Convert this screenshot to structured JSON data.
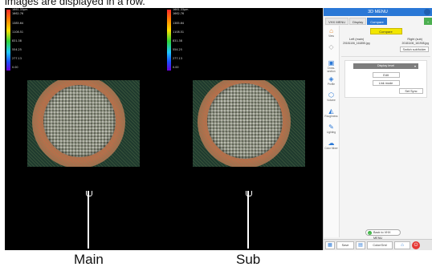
{
  "caption_top": "images are displayed in a row.",
  "labels": {
    "main": "Main",
    "sub": "Sub"
  },
  "scale_main": [
    "1661.33μm",
    "1662.76",
    "1385.64",
    "1108.51",
    "831.38",
    "554.25",
    "277.13",
    "0.00"
  ],
  "scale_sub": [
    "1661.33μm",
    "1662.76",
    "1385.64",
    "1108.51",
    "831.38",
    "554.25",
    "277.13",
    "0.00"
  ],
  "panel": {
    "title": "3D MENU",
    "tabs": [
      "VHX MENU",
      "Display",
      "Compare"
    ],
    "active_tab": "Compare",
    "badge": "+",
    "sidebar": [
      "View",
      "Overlay",
      "Cross-section",
      "Profile",
      "Volume",
      "Roughness",
      "Lighting",
      "Color Mixer"
    ],
    "compare_button": "Compare",
    "left_label": "Left (main)",
    "right_label": "Right (sub)",
    "left_file": "20181106_161855.jpg",
    "right_file": "20181106_161908.jpg",
    "switch_button": "Switch sub/folder",
    "display_select": "Display level",
    "edit_button": "Edit",
    "link_button": "Link mode",
    "sync_button": "Set Sync",
    "back_button": "Back to VHX MENU",
    "bottom": {
      "save": "Save",
      "color": "Color/Grid"
    }
  },
  "colors": {
    "accent": "#2a78d6",
    "compare": "#f2e600",
    "power": "#e53935"
  }
}
